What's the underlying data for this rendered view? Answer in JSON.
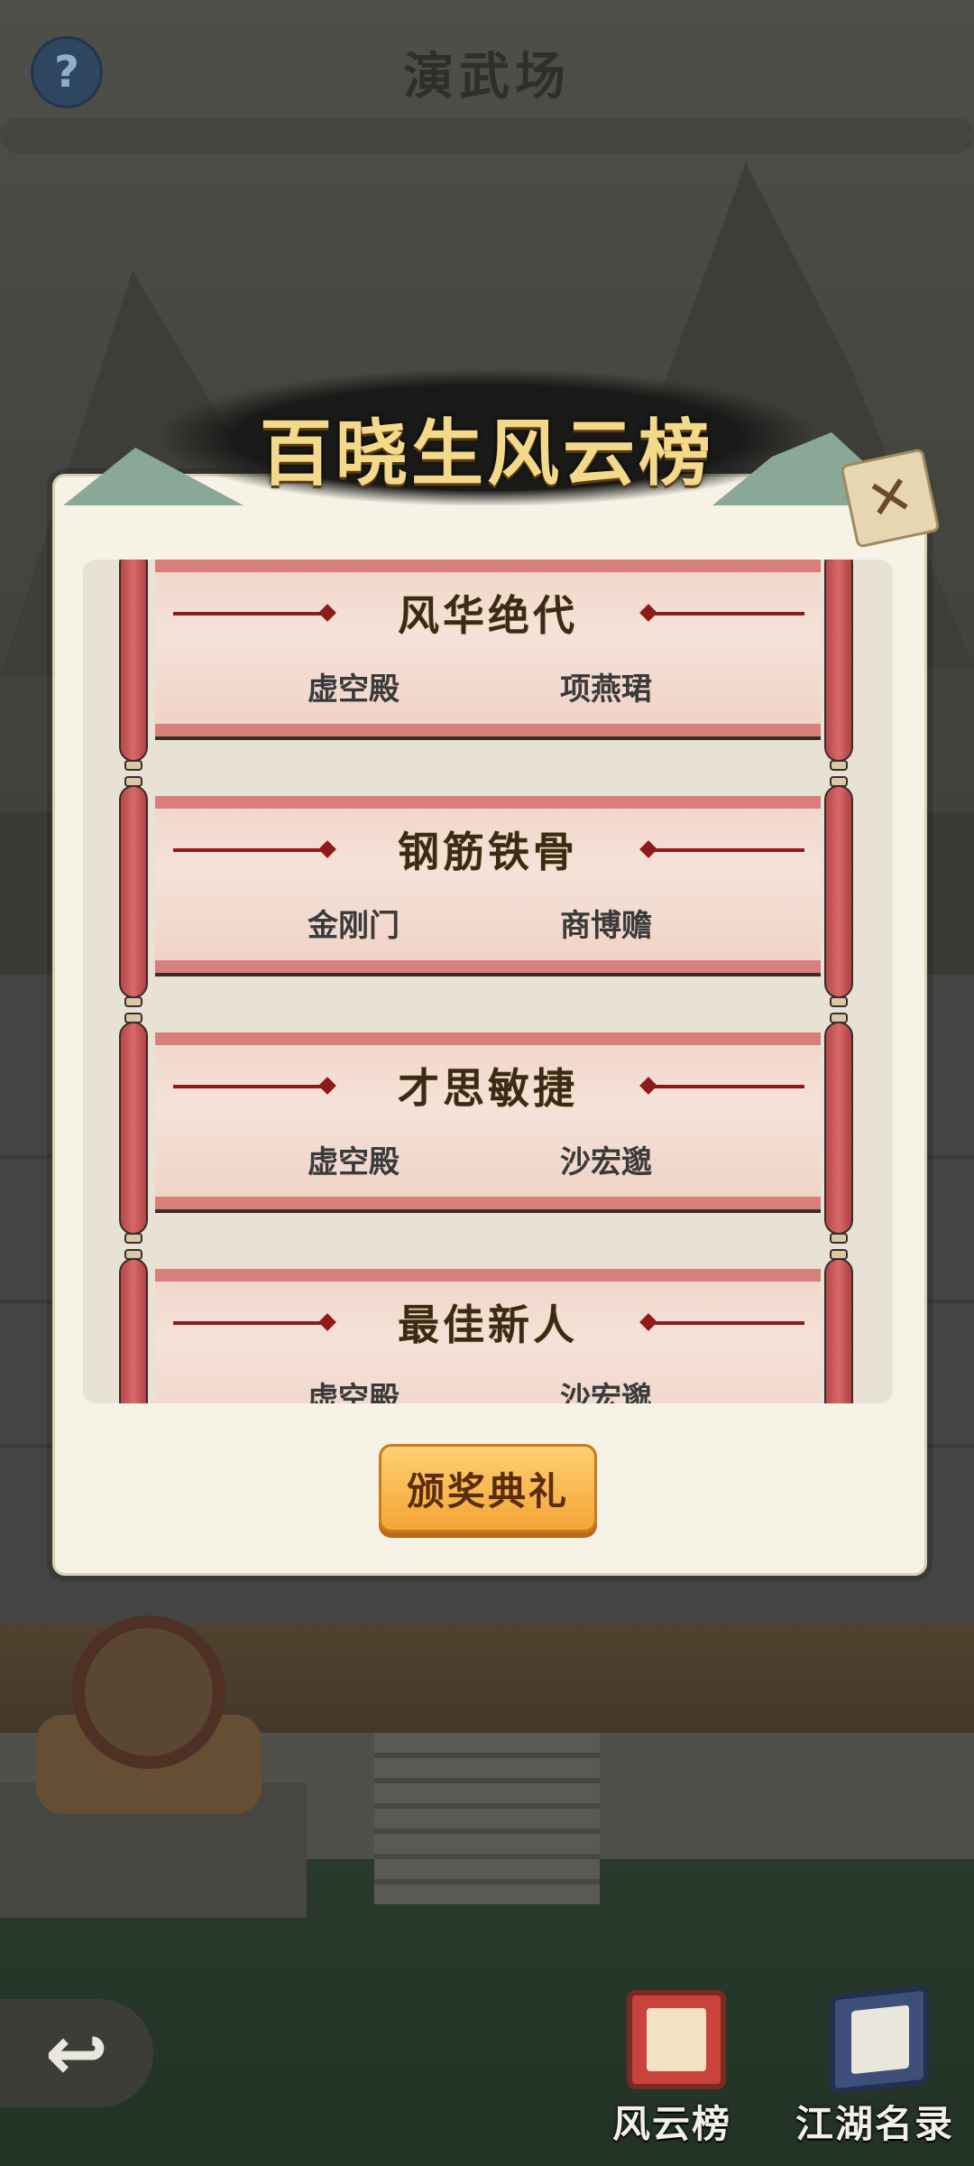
{
  "page": {
    "title": "演武场"
  },
  "topbar": {
    "help_icon": "?"
  },
  "modal": {
    "title": "百晓生风云榜",
    "close_icon": "✕",
    "awards": [
      {
        "title": "风华绝代",
        "sect": "虚空殿",
        "person": "项燕珺"
      },
      {
        "title": "钢筋铁骨",
        "sect": "金刚门",
        "person": "商博赡"
      },
      {
        "title": "才思敏捷",
        "sect": "虚空殿",
        "person": "沙宏邈"
      },
      {
        "title": "最佳新人",
        "sect": "虚空殿",
        "person": "沙宏邈"
      }
    ],
    "ceremony_button": "颁奖典礼"
  },
  "nav": {
    "back_icon": "↩",
    "fengyun_label": "风云榜",
    "jianghu_label": "江湖名录"
  },
  "colors": {
    "ceremony_button": "#f4a536",
    "scroll_rod": "#c85556",
    "scroll_paper": "#f3dcd1",
    "title_gold": "#f3d98a"
  }
}
